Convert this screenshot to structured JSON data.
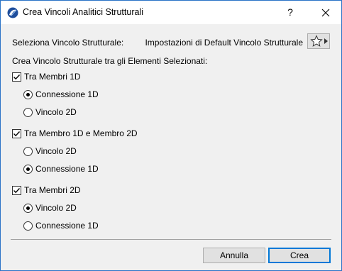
{
  "window": {
    "title": "Crea Vincoli Analitici Strutturali",
    "help_label": "?"
  },
  "selection": {
    "label": "Seleziona Vincolo Strutturale:",
    "value": "Impostazioni di Default Vincolo Strutturale"
  },
  "section_heading": "Crea Vincolo Strutturale tra gli Elementi Selezionati:",
  "groups": [
    {
      "label": "Tra Membri 1D",
      "checked": true,
      "options": [
        {
          "label": "Connessione 1D",
          "selected": true
        },
        {
          "label": "Vincolo 2D",
          "selected": false
        }
      ]
    },
    {
      "label": "Tra Membro 1D e Membro 2D",
      "checked": true,
      "options": [
        {
          "label": "Vincolo 2D",
          "selected": false
        },
        {
          "label": "Connessione 1D",
          "selected": true
        }
      ]
    },
    {
      "label": "Tra Membri 2D",
      "checked": true,
      "options": [
        {
          "label": "Vincolo 2D",
          "selected": true
        },
        {
          "label": "Connessione 1D",
          "selected": false
        }
      ]
    }
  ],
  "buttons": {
    "cancel": "Annulla",
    "ok": "Crea"
  },
  "colors": {
    "accent": "#0078d7",
    "window_border": "#2b73c7"
  }
}
